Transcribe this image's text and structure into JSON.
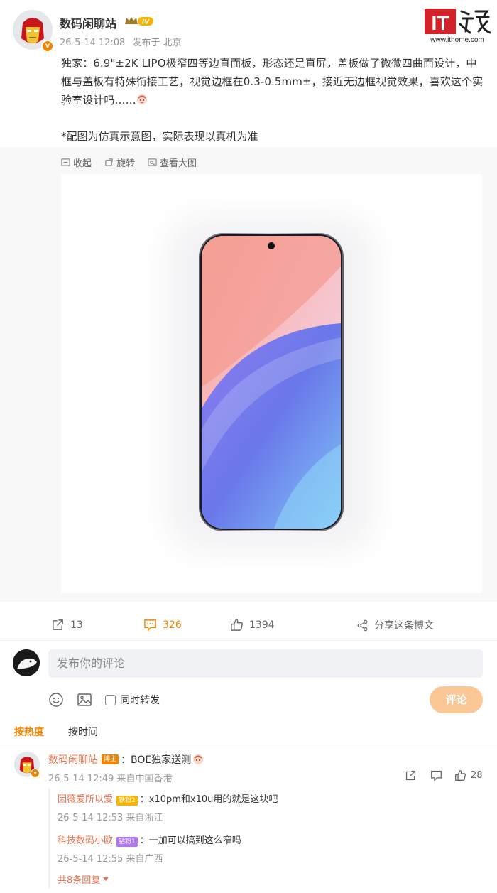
{
  "post": {
    "author": "数码闲聊站",
    "vip_level": "IV",
    "time": "26-5-14 12:08",
    "location": "发布于 北京",
    "text": "独家：6.9\"±2K LIPO极窄四等边直面板，形态还是直屏，盖板做了微微四曲面设计，中框与盖板有特殊衔接工艺，视觉边框在0.3-0.5mm±，接近无边框视觉效果，喜欢这个实验室设计吗……",
    "note": "*配图为仿真示意图，实际表现以真机为准"
  },
  "watermark": {
    "logo_text": "IT之家",
    "url": "www.ithome.com"
  },
  "media": {
    "tools": [
      {
        "icon": "collapse-icon",
        "label": "收起"
      },
      {
        "icon": "rotate-icon",
        "label": "旋转"
      },
      {
        "icon": "view-large-icon",
        "label": "查看大图"
      }
    ]
  },
  "actions": {
    "repost_count": "13",
    "comment_count": "326",
    "like_count": "1394",
    "share_label": "分享这条博文"
  },
  "comment_box": {
    "placeholder": "发布你的评论",
    "repost_label": "同时转发",
    "submit_label": "评论"
  },
  "sort": {
    "hot": "按热度",
    "time": "按时间"
  },
  "comment": {
    "author": "数码闲聊站",
    "badge": "博主",
    "text": "：BOE独家送测",
    "time": "26-5-14 12:49",
    "location": "来自中国香港",
    "like_count": "28"
  },
  "replies": [
    {
      "name": "因薇爱所以爱",
      "badge": "铁粉2",
      "text": "：x10pm和x10u用的就是这块吧",
      "time": "26-5-14 12:53",
      "location": "来自浙江"
    },
    {
      "name": "科技数码小欧",
      "badge": "钻粉1",
      "text": "：一加可以搞到这么窄吗",
      "time": "26-5-14 12:55",
      "location": "来自广西"
    }
  ],
  "more_replies": "共8条回复",
  "colors": {
    "accent": "#f08400",
    "name_link": "#eb7350",
    "submit_disabled": "#fbc895"
  }
}
